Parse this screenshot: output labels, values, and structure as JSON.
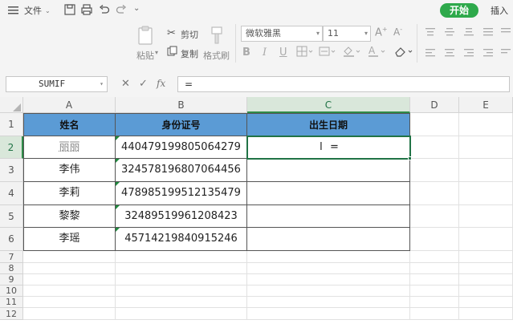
{
  "menubar": {
    "file_label": "文件",
    "start_label": "开始",
    "insert_label": "插入"
  },
  "ribbon": {
    "paste_label": "粘贴",
    "cut_label": "剪切",
    "copy_label": "复制",
    "format_painter_label": "格式刷",
    "font_name": "微软雅黑",
    "font_size": "11",
    "bold_label": "B",
    "italic_label": "I",
    "underline_label": "U"
  },
  "formulabar": {
    "name_box": "SUMIF",
    "formula": "=",
    "fx_label": "fx"
  },
  "sheet": {
    "columns": [
      "A",
      "B",
      "C",
      "D",
      "E"
    ],
    "rows": [
      "1",
      "2",
      "3",
      "4",
      "5",
      "6",
      "7",
      "8",
      "9",
      "10",
      "11",
      "12"
    ],
    "headers": [
      "姓名",
      "身份证号",
      "出生日期"
    ],
    "data": [
      {
        "name": "丽丽",
        "id": "440479199805064279",
        "birth": "="
      },
      {
        "name": "李伟",
        "id": "324578196807064456",
        "birth": ""
      },
      {
        "name": "李莉",
        "id": "478985199512135479",
        "birth": ""
      },
      {
        "name": "黎黎",
        "id": "32489519961208423",
        "birth": ""
      },
      {
        "name": "李瑶",
        "id": "45714219840915246",
        "birth": ""
      }
    ],
    "header_color": "#5b9bd5",
    "accent_color": "#217346"
  }
}
